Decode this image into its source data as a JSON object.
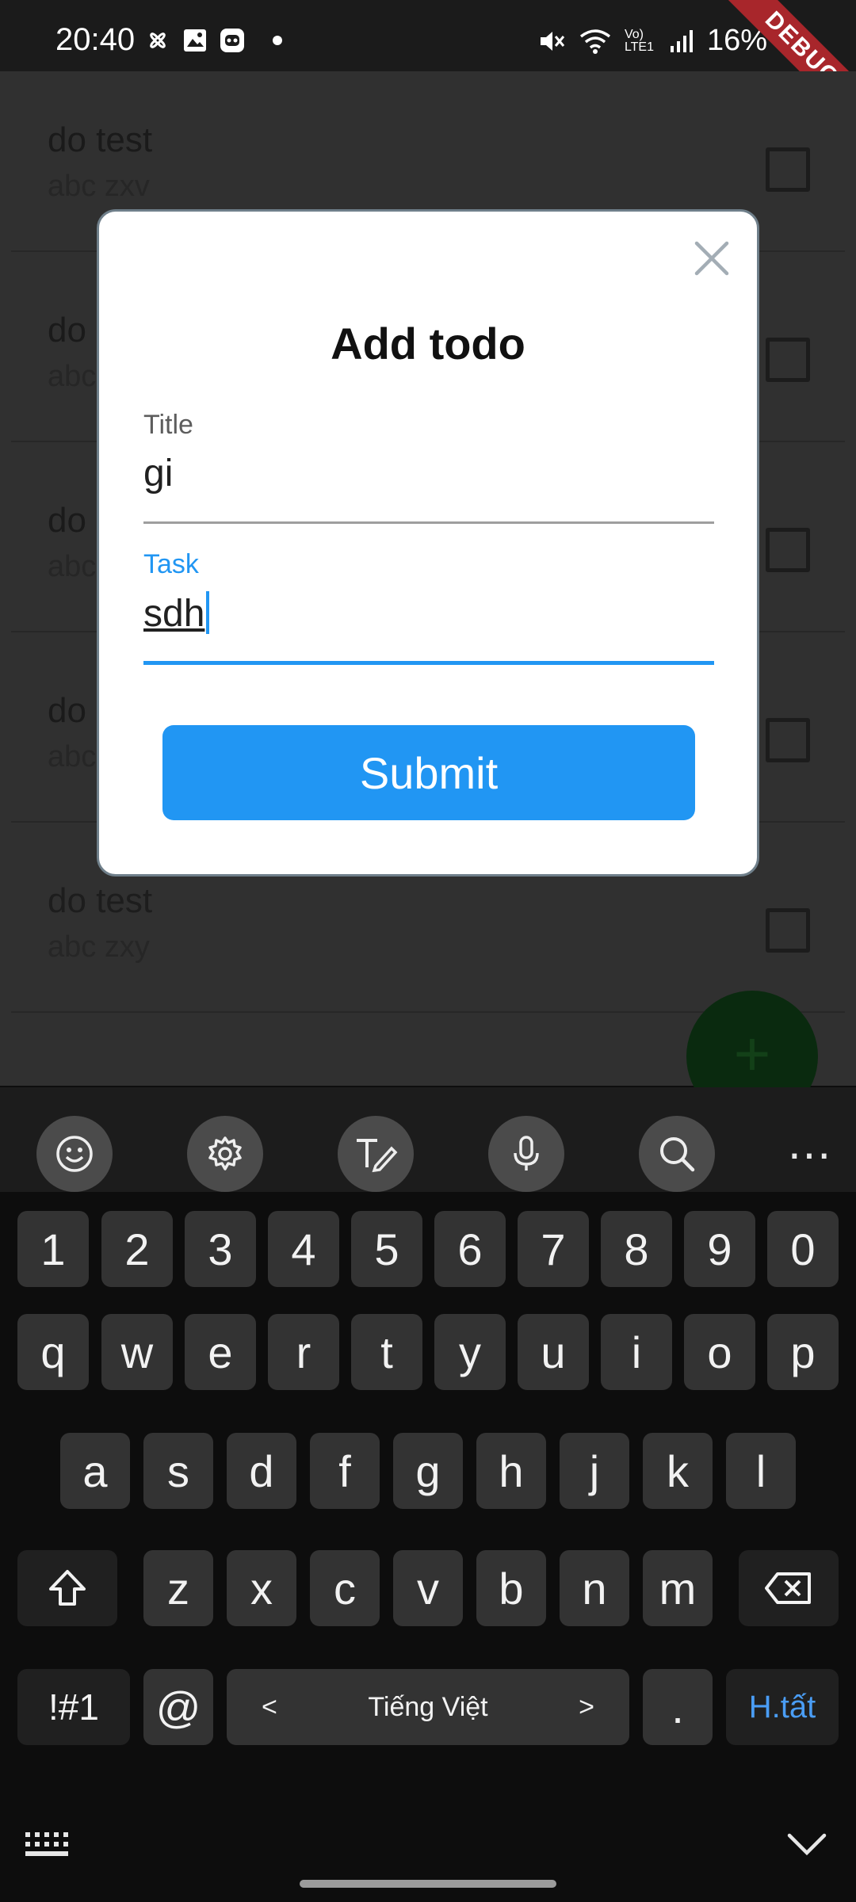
{
  "status_bar": {
    "time": "20:40",
    "battery": "16%",
    "debug_banner": "DEBUG",
    "icons_left": [
      "pinwheel-icon",
      "image-icon",
      "robot-icon",
      "dot-icon"
    ],
    "icons_right": [
      "mute-icon",
      "wifi-icon",
      "volte-icon",
      "signal-icon"
    ],
    "volte_label": "Vo) LTE1"
  },
  "list": {
    "items": [
      {
        "title": "do test",
        "subtitle": "abc zxv"
      },
      {
        "title": "do",
        "subtitle": "abc"
      },
      {
        "title": "do",
        "subtitle": "abc"
      },
      {
        "title": "do",
        "subtitle": "abc"
      },
      {
        "title": "do test",
        "subtitle": "abc zxy"
      }
    ],
    "fab_icon": "plus-icon",
    "fab_label": "+"
  },
  "dialog": {
    "title": "Add todo",
    "fields": [
      {
        "label": "Title",
        "value": "gi"
      },
      {
        "label": "Task",
        "value": "sdh"
      }
    ],
    "submit_label": "Submit",
    "close_icon": "close-icon"
  },
  "keyboard": {
    "toolbar_icons": [
      "emoji-icon",
      "settings-icon",
      "handwriting-icon",
      "microphone-icon",
      "search-icon",
      "more-icon"
    ],
    "more_label": "...",
    "row_numbers": [
      "1",
      "2",
      "3",
      "4",
      "5",
      "6",
      "7",
      "8",
      "9",
      "0"
    ],
    "row_1": [
      "q",
      "w",
      "e",
      "r",
      "t",
      "y",
      "u",
      "i",
      "o",
      "p"
    ],
    "row_2": [
      "a",
      "s",
      "d",
      "f",
      "g",
      "h",
      "j",
      "k",
      "l"
    ],
    "row_3": [
      "z",
      "x",
      "c",
      "v",
      "b",
      "n",
      "m"
    ],
    "symbols_label": "!#1",
    "at_label": "@",
    "space_label": "Tiếng Việt",
    "space_left": "<",
    "space_right": ">",
    "period_label": ".",
    "done_label": "H.tất"
  },
  "colors": {
    "accent": "#2196f3",
    "dialog_bg": "#ffffff",
    "key_bg": "#333333",
    "debug": "#a8262b"
  }
}
